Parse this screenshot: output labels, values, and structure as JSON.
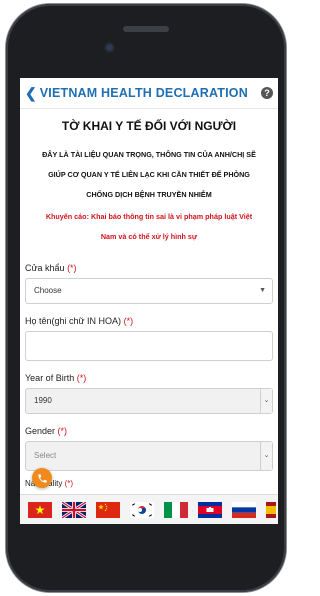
{
  "header": {
    "back_icon": "back-arrow-icon",
    "title": "VIETNAM HEALTH DECLARATION",
    "help_icon": "?"
  },
  "form": {
    "title": "TỜ KHAI Y TẾ ĐỐI VỚI NGƯỜI",
    "notice_lines": [
      "ĐÂY LÀ TÀI LIỆU QUAN TRỌNG, THÔNG TIN CỦA ANH/CHỊ SẼ",
      "GIÚP CƠ QUAN Y TẾ LIÊN LẠC KHI CẦN THIẾT ĐỂ PHÒNG",
      "CHỐNG DỊCH BỆNH TRUYỀN NHIỄM"
    ],
    "warning_lines": [
      "Khuyến cáo: Khai báo thông tin sai là vi phạm pháp luật Việt",
      "Nam và có thể xử lý hình sự"
    ],
    "required_mark": "(*)",
    "fields": {
      "border_gate": {
        "label": "Cửa khẩu",
        "value": "Choose"
      },
      "full_name": {
        "label": "Họ tên(ghi chữ IN HOA)",
        "value": ""
      },
      "year_of_birth": {
        "label": "Year of Birth",
        "value": "1990"
      },
      "gender": {
        "label": "Gender",
        "value": "Select"
      },
      "nationality": {
        "label": "Nationality"
      }
    }
  },
  "languages": [
    "vietnamese",
    "english",
    "chinese",
    "korean",
    "italian",
    "khmer",
    "russian",
    "spanish"
  ],
  "colors": {
    "accent": "#1f6fb2",
    "warning": "#d0141c",
    "fab": "#f08a1c"
  }
}
